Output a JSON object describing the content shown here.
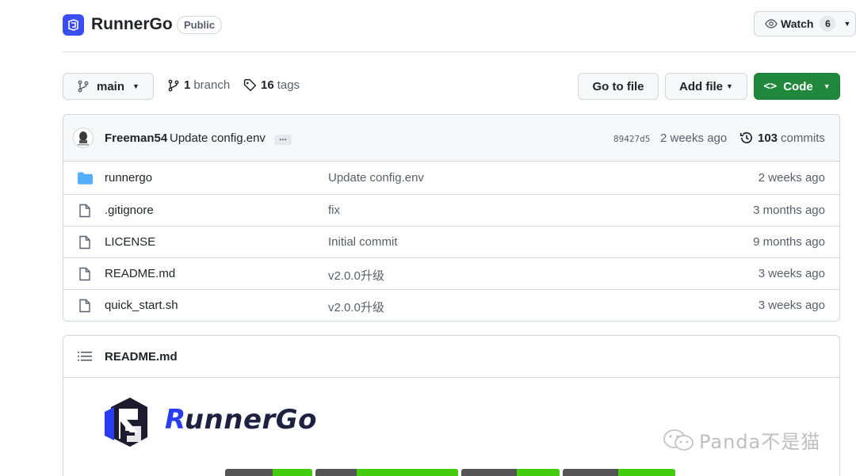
{
  "repo": {
    "name": "RunnerGo",
    "visibility": "Public",
    "watch_label": "Watch",
    "watch_count": "6"
  },
  "toolbar": {
    "branch": "main",
    "branch_count": "1",
    "branch_label": "branch",
    "tag_count": "16",
    "tag_label": "tags",
    "goto_file": "Go to file",
    "add_file": "Add file",
    "code": "Code"
  },
  "latest_commit": {
    "author": "Freeman54",
    "message": "Update config.env",
    "ellipsis": "…",
    "sha": "89427d5",
    "time": "2 weeks ago",
    "commit_count": "103",
    "commit_label": "commits"
  },
  "files": [
    {
      "name": "runnergo",
      "type": "folder",
      "commit": "Update config.env",
      "time": "2 weeks ago"
    },
    {
      "name": ".gitignore",
      "type": "file",
      "commit": "fix",
      "time": "3 months ago"
    },
    {
      "name": "LICENSE",
      "type": "file",
      "commit": "Initial commit",
      "time": "9 months ago"
    },
    {
      "name": "README.md",
      "type": "file",
      "commit": "v2.0.0升级",
      "time": "3 weeks ago"
    },
    {
      "name": "quick_start.sh",
      "type": "file",
      "commit": "v2.0.0升级",
      "time": "3 weeks ago"
    }
  ],
  "readme": {
    "title": "README.md",
    "brand_first": "R",
    "brand_rest": "unnerGo"
  },
  "watermark": "Panda不是猫",
  "colors": {
    "primary_button": "#1f883d",
    "brand_blue": "#3b4ef5",
    "folder_blue": "#54aeff",
    "badge_green": "#44cc11"
  }
}
